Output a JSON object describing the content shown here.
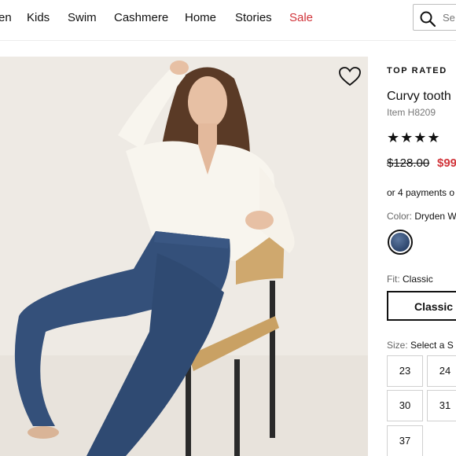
{
  "nav": {
    "items": [
      "en",
      "Kids",
      "Swim",
      "Cashmere",
      "Home",
      "Stories",
      "Sale"
    ],
    "search_placeholder": "Se"
  },
  "product": {
    "badge": "TOP RATED",
    "title": "Curvy tooth",
    "item_number": "Item H8209",
    "rating_stars": "★★★★",
    "original_price": "$128.00",
    "sale_price": "$99",
    "payments_text": "or 4 payments o",
    "color_label": "Color:",
    "color_value": "Dryden W",
    "fit_label": "Fit:",
    "fit_value": "Classic",
    "fit_option": "Classic",
    "size_label": "Size:",
    "size_value": "Select a S",
    "sizes": [
      "23",
      "24",
      "30",
      "31",
      "37"
    ]
  },
  "colors": {
    "sale": "#d1343a",
    "swatch": "#2d466d"
  },
  "icons": {
    "search": "search-icon",
    "wishlist": "heart-icon",
    "star": "star-icon"
  }
}
